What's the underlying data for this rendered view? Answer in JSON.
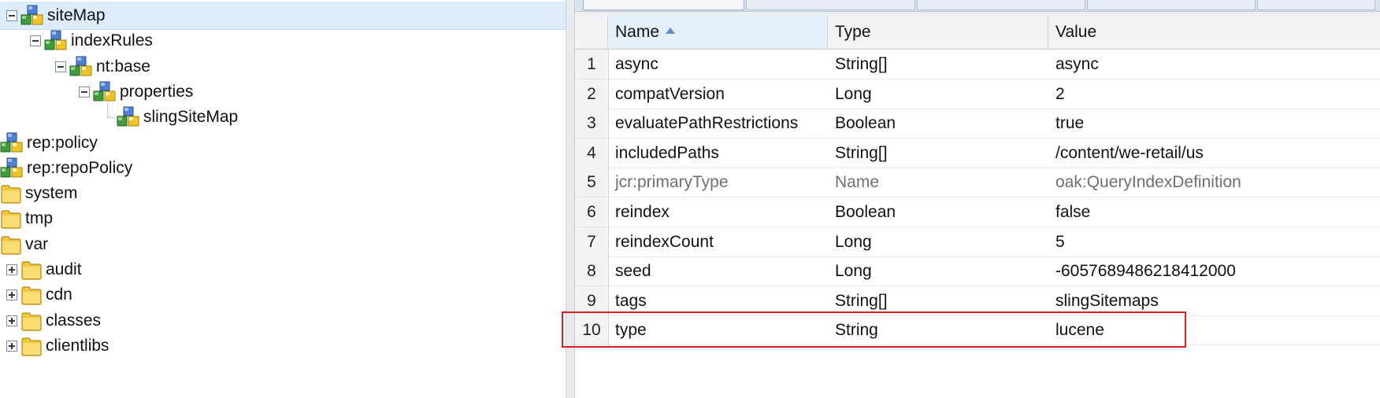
{
  "tree": {
    "nodes": [
      {
        "label": "siteMap",
        "icon": "node-icon",
        "expander": "minus",
        "selected": true
      },
      {
        "label": "indexRules",
        "icon": "node-icon",
        "expander": "minus"
      },
      {
        "label": "nt:base",
        "icon": "node-icon",
        "expander": "minus"
      },
      {
        "label": "properties",
        "icon": "node-icon",
        "expander": "minus"
      },
      {
        "label": "slingSiteMap",
        "icon": "node-icon",
        "expander": "none"
      },
      {
        "label": "rep:policy",
        "icon": "node-icon",
        "expander": "none"
      },
      {
        "label": "rep:repoPolicy",
        "icon": "node-icon",
        "expander": "none"
      },
      {
        "label": "system",
        "icon": "folder-icon",
        "expander": "none"
      },
      {
        "label": "tmp",
        "icon": "folder-icon",
        "expander": "none"
      },
      {
        "label": "var",
        "icon": "folder-icon",
        "expander": "none"
      },
      {
        "label": "audit",
        "icon": "folder-icon",
        "expander": "plus"
      },
      {
        "label": "cdn",
        "icon": "folder-icon",
        "expander": "plus"
      },
      {
        "label": "classes",
        "icon": "folder-icon",
        "expander": "plus"
      },
      {
        "label": "clientlibs",
        "icon": "folder-icon",
        "expander": "plus"
      }
    ]
  },
  "grid": {
    "headers": {
      "name": "Name",
      "type": "Type",
      "value": "Value"
    },
    "sorted_column": "name",
    "rows": [
      {
        "num": "1",
        "name": "async",
        "type": "String[]",
        "value": "async"
      },
      {
        "num": "2",
        "name": "compatVersion",
        "type": "Long",
        "value": "2"
      },
      {
        "num": "3",
        "name": "evaluatePathRestrictions",
        "type": "Boolean",
        "value": "true"
      },
      {
        "num": "4",
        "name": "includedPaths",
        "type": "String[]",
        "value": "/content/we-retail/us"
      },
      {
        "num": "5",
        "name": "jcr:primaryType",
        "type": "Name",
        "value": "oak:QueryIndexDefinition",
        "protected": true
      },
      {
        "num": "6",
        "name": "reindex",
        "type": "Boolean",
        "value": "false"
      },
      {
        "num": "7",
        "name": "reindexCount",
        "type": "Long",
        "value": "5"
      },
      {
        "num": "8",
        "name": "seed",
        "type": "Long",
        "value": "-6057689486218412000"
      },
      {
        "num": "9",
        "name": "tags",
        "type": "String[]",
        "value": "slingSitemaps",
        "highlighted": true
      },
      {
        "num": "10",
        "name": "type",
        "type": "String",
        "value": "lucene"
      }
    ]
  },
  "colors": {
    "selection": "#dcecfb",
    "highlight_border": "#d81f1f",
    "sort_arrow": "#5f8dc0"
  }
}
